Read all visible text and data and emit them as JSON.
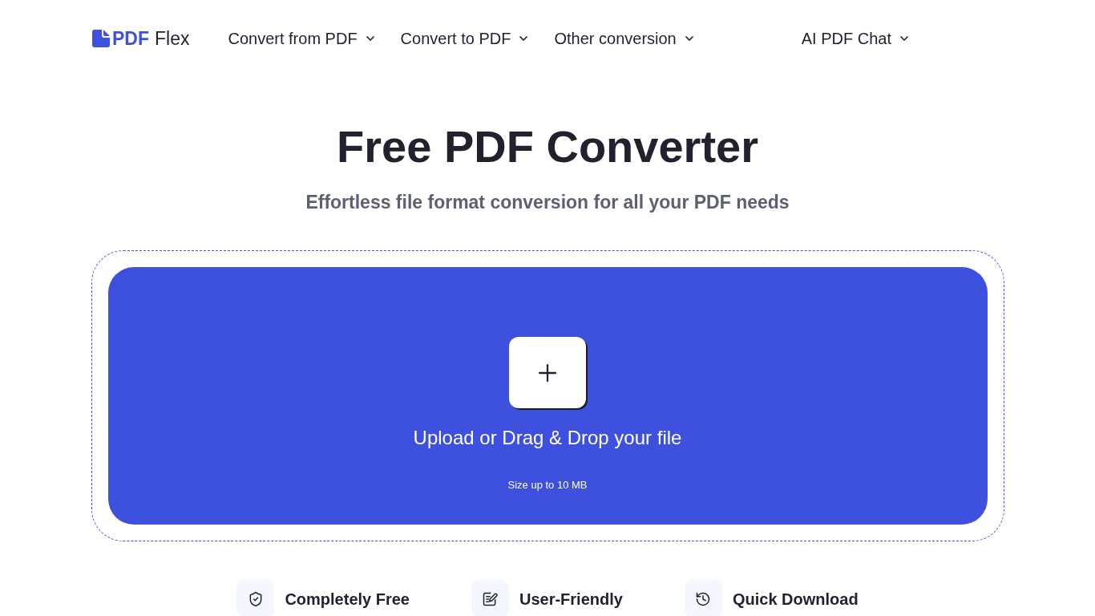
{
  "header": {
    "logo": {
      "brand": "PDF",
      "suffix": "Flex"
    },
    "nav": [
      {
        "label": "Convert from PDF",
        "has_menu": true
      },
      {
        "label": "Convert to PDF",
        "has_menu": true
      },
      {
        "label": "Other conversion",
        "has_menu": true
      }
    ],
    "right_nav": [
      {
        "label": "AI PDF Chat",
        "has_menu": true
      }
    ]
  },
  "hero": {
    "title": "Free PDF Converter",
    "subtitle": "Effortless file format conversion for all your PDF needs"
  },
  "upload": {
    "prompt": "Upload or Drag & Drop your file",
    "limit": "Size up to 10 MB"
  },
  "features": [
    {
      "label": "Completely Free"
    },
    {
      "label": "User-Friendly"
    },
    {
      "label": "Quick Download"
    }
  ]
}
